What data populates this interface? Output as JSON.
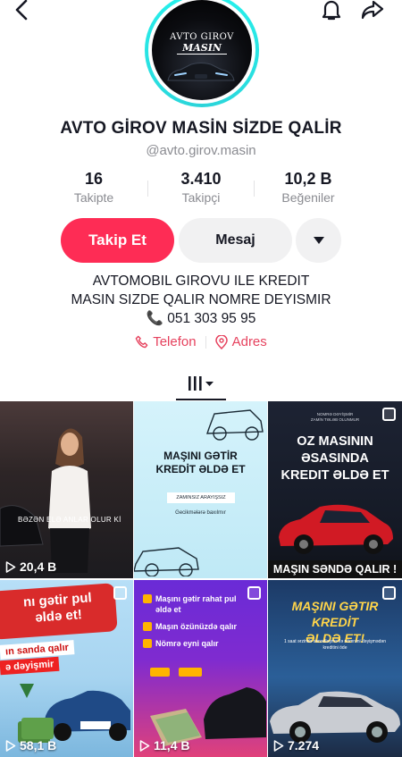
{
  "profile": {
    "avatar_line1": "AVTO GIROV",
    "avatar_line2": "MASIN",
    "display_name": "AVTO GİROV MASİN SİZDE QALİR",
    "handle": "@avto.girov.masin"
  },
  "stats": [
    {
      "value": "16",
      "label": "Takipte"
    },
    {
      "value": "3.410",
      "label": "Takipçi"
    },
    {
      "value": "10,2 B",
      "label": "Beğeniler"
    }
  ],
  "actions": {
    "follow_label": "Takip Et",
    "message_label": "Mesaj"
  },
  "bio": {
    "line1": "AVTOMOBIL GIROVU ILE KREDIT",
    "line2": "MASIN SIZDE QALIR NOMRE DEYISMIR",
    "line3": "📞 051 303 95 95"
  },
  "links": {
    "phone_label": "Telefon",
    "address_label": "Adres"
  },
  "videos": [
    {
      "views": "20,4 B",
      "caption": "BƏZƏN ELƏ ANLAR OLUR Kİ"
    },
    {
      "views": "",
      "title_line1": "MAŞINI GƏTİR",
      "title_line2": "KREDİT ƏLDƏ ET",
      "pill": "ZAMINSIZ ARAYIŞSIZ",
      "sub": "Gecikmələrə baxılmır"
    },
    {
      "views": "",
      "small_line1": "NOMRƏ DƏYİŞMİR",
      "small_line2": "ZAMİN TƏLƏB OLUNMUR",
      "title_line1": "OZ MASININ",
      "title_line2": "ƏSASINDA",
      "title_line3": "KREDIT ƏLDƏ ET",
      "banner": "MAŞIN SƏNDƏ QALIR !"
    },
    {
      "views": "58,1 B",
      "line1": "nı gətir pul",
      "line2": "əldə et!",
      "line3": "ın sanda qalır",
      "line4": "ə dəyişmir"
    },
    {
      "views": "11,4 B",
      "item1": "Maşını gətir rahat pul əldə et",
      "item2": "Maşın özünüzdə qalır",
      "item3": "Nömrə eyni qalır"
    },
    {
      "views": "7.274",
      "title_line1": "MAŞINI GƏTIR KREDİT",
      "title_line2": "ƏLDƏ ET!",
      "sub": "1 saat ərzində sənədləşmə ilə nömrəni dəyişmədən kreditini öde"
    }
  ],
  "colors": {
    "accent": "#fe2c55",
    "link": "#e6425e",
    "muted": "#8a8b91",
    "avatar_ring": "#25f4ee"
  },
  "icons": [
    "back-arrow-icon",
    "bell-icon",
    "share-icon",
    "caret-down-icon",
    "phone-icon",
    "location-pin-icon",
    "grid-tab-icon",
    "play-icon",
    "multi-photo-icon"
  ]
}
